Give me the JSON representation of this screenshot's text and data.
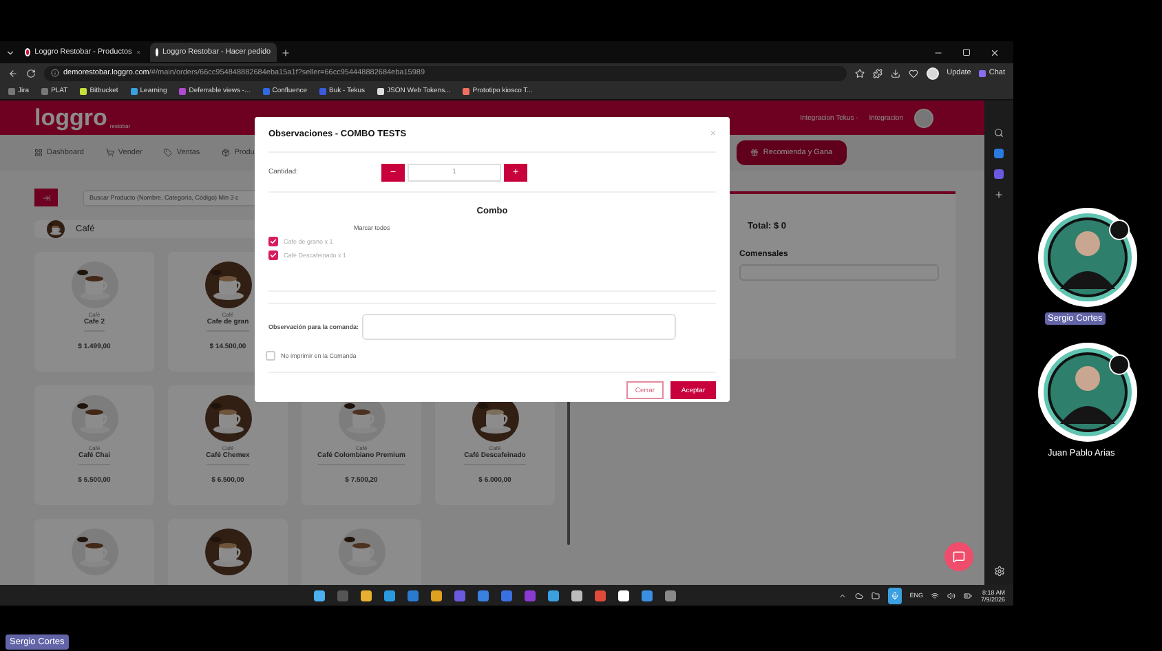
{
  "browser": {
    "tabs": [
      {
        "label": "Loggro Restobar - Productos",
        "selected": false
      },
      {
        "label": "Loggro Restobar - Hacer pedido",
        "selected": true
      }
    ],
    "url_host": "demorestobar.loggro.com",
    "url_path": "/#/main/orders/66cc954848882684eba15a1f?seller=66cc954448882684eba15989",
    "update_label": "Update",
    "chat_label": "Chat",
    "bookmarks": [
      "Jira",
      "PLAT",
      "Bitbucket",
      "Learning",
      "Deferrable views -...",
      "Confluence",
      "Buk - Tekus",
      "JSON Web Tokens...",
      "Prototipo kiosco T..."
    ]
  },
  "app": {
    "logo": "loggro",
    "logo_sub": "restobar",
    "user_company": "Integracion Tekus -",
    "user_name": "Integracion",
    "nav": [
      "Dashboard",
      "Vender",
      "Ventas",
      "Produ"
    ],
    "recommend_button": "Recomienda y Gana",
    "search_placeholder": "Buscar Producto (Nombre, Categoría, Código) Min 3 c",
    "category": "Café",
    "products": [
      {
        "kind": "product",
        "category": "Café",
        "name": "Cafe 2",
        "price": "$ 1.499,00"
      },
      {
        "kind": "product",
        "category": "Café",
        "name": "Cafe de gran",
        "price": "$ 14.500,00"
      },
      {
        "kind": "hidden"
      },
      {
        "kind": "hidden"
      },
      {
        "kind": "product",
        "category": "Café",
        "name": "Café Chai",
        "price": "$ 6.500,00"
      },
      {
        "kind": "product",
        "category": "Café",
        "name": "Café Chemex",
        "price": "$ 6.500,00"
      },
      {
        "kind": "product",
        "category": "Café",
        "name": "Café Colombiano Premium",
        "price": "$ 7.500,20"
      },
      {
        "kind": "product",
        "category": "Café",
        "name": "Café Descafeinado",
        "price": "$ 6.000,00"
      },
      {
        "kind": "picture"
      },
      {
        "kind": "picture"
      },
      {
        "kind": "picture"
      }
    ],
    "total": "Total: $ 0",
    "diners_label": "Comensales"
  },
  "modal": {
    "title": "Observaciones - COMBO TESTS",
    "close": "×",
    "quantity_label": "Cantidad:",
    "minus": "−",
    "quantity": "1",
    "plus": "+",
    "section": "Combo",
    "select_all": "Marcar todos",
    "items": [
      {
        "label": "Cafe de grano x 1",
        "checked": true
      },
      {
        "label": "Café Descafeinado x 1",
        "checked": true
      }
    ],
    "note_label": "Observación para la comanda:",
    "no_print": {
      "label": "No imprimir en la Comanda",
      "checked": false
    },
    "buttons": [
      {
        "label": "Cerrar",
        "kind": "secondary"
      },
      {
        "label": "Aceptar",
        "kind": "primary"
      }
    ]
  },
  "taskbar": {
    "lang": "ENG",
    "time": "8:18 AM",
    "date": "7/9/2026"
  },
  "participants": [
    {
      "name": "Sergio Cortes",
      "highlighted": true
    },
    {
      "name": "Juan Pablo Arias",
      "highlighted": false
    }
  ],
  "presenter": "Sergio Cortes"
}
